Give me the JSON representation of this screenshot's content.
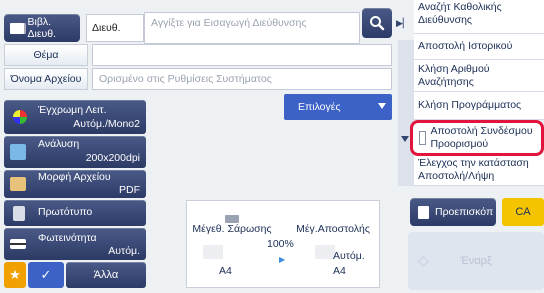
{
  "header": {
    "address_book_label": "Βιβλ. Διευθ.",
    "dest_label": "Διευθ.",
    "dest_placeholder": "Αγγίξτε για Εισαγωγή Διεύθυνσης"
  },
  "form": {
    "subject_label": "Θέμα",
    "subject_value": "",
    "filename_label": "Όνομα Αρχείου",
    "filename_placeholder": "Ορισμένο στις Ρυθμίσεις Συστήματος",
    "options_label": "Επιλογές"
  },
  "left_tiles": [
    {
      "title": "Έγχρωμη Λειτ.",
      "value": "Αυτόμ./Mono2"
    },
    {
      "title": "Ανάλυση",
      "value": "200x200dpi"
    },
    {
      "title": "Μορφή Αρχείου",
      "value": "PDF"
    },
    {
      "title": "Πρωτότυπο",
      "value": ""
    },
    {
      "title": "Φωτεινότητα",
      "value": "Αυτόμ."
    }
  ],
  "bottom_bar": {
    "other_label": "Άλλα"
  },
  "center": {
    "scan_size_label": "Μέγεθ. Σάρωσης",
    "send_size_label": "Μέγ.Αποστολής",
    "ratio": "100%",
    "send_mode": "Αυτόμ.",
    "scan_paper": "A4",
    "send_paper": "A4"
  },
  "right_list": [
    "Αναζήτ Καθολικής Διεύθυνσης",
    "Αποστολή Ιστορικού",
    "Κλήση Αριθμού Αναζήτησης",
    "Κλήση Προγράμματος",
    "Αποστολή Συνδέσμου Προορισμού",
    "Έλεγχος την κατάσταση Αποστολή/Λήψη"
  ],
  "actions": {
    "preview_label": "Προεπισκόπ",
    "ca_label": "CA",
    "start_label": "Έναρξ"
  },
  "colors": {
    "accent": "#3c62c8",
    "highlight": "#e0143c",
    "ca": "#f5c400"
  }
}
